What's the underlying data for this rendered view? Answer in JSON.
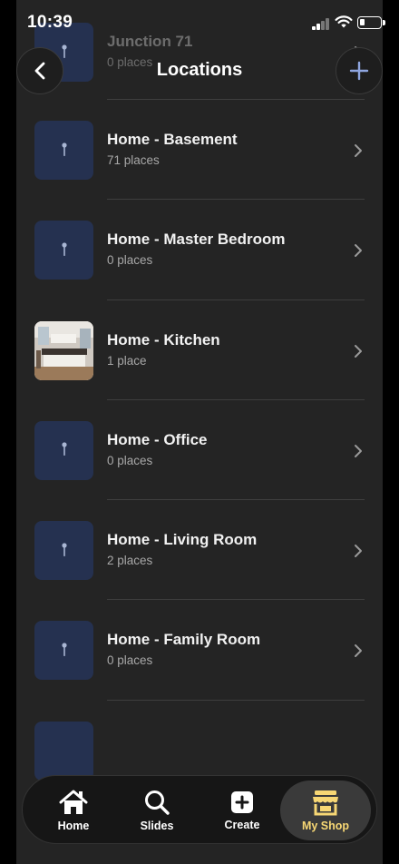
{
  "status_bar": {
    "time": "10:39"
  },
  "header": {
    "title": "Locations"
  },
  "locations": [
    {
      "name": "Junction 71",
      "count": "0 places",
      "thumbnail": "pin-icon"
    },
    {
      "name": "Home - Basement",
      "count": "71 places",
      "thumbnail": "pin-icon"
    },
    {
      "name": "Home - Master Bedroom",
      "count": "0 places",
      "thumbnail": "pin-icon"
    },
    {
      "name": "Home - Kitchen",
      "count": "1 place",
      "thumbnail": "kitchen-photo"
    },
    {
      "name": "Home - Office",
      "count": "0 places",
      "thumbnail": "pin-icon"
    },
    {
      "name": "Home - Living Room",
      "count": "2 places",
      "thumbnail": "pin-icon"
    },
    {
      "name": "Home - Family Room",
      "count": "0 places",
      "thumbnail": "pin-icon"
    }
  ],
  "nav": {
    "items": [
      {
        "label": "Home",
        "icon": "house-icon"
      },
      {
        "label": "Slides",
        "icon": "search-icon"
      },
      {
        "label": "Create",
        "icon": "plus-square-icon"
      },
      {
        "label": "My Shop",
        "icon": "storefront-icon"
      }
    ],
    "active": "My Shop"
  },
  "colors": {
    "accent": "#f7d774",
    "thumb_bg": "#253150",
    "sheet_bg": "#242424",
    "add_icon": "#8fa6e0"
  }
}
